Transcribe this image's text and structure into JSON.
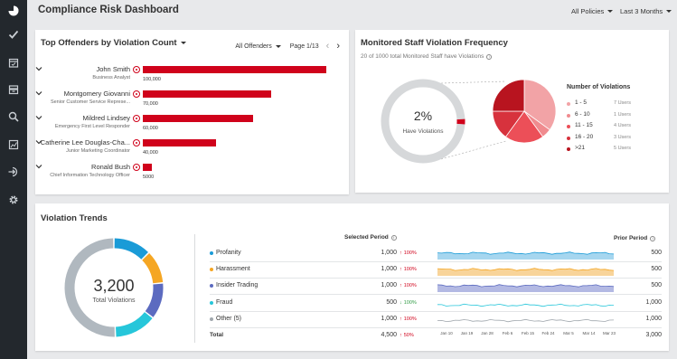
{
  "header": {
    "title": "Compliance Risk Dashboard",
    "policy_filter": "All Policies",
    "period_filter": "Last 3 Months"
  },
  "sidebar": {
    "items": [
      {
        "icon": "pie-chart-icon"
      },
      {
        "icon": "check-icon"
      },
      {
        "icon": "calendar-icon"
      },
      {
        "icon": "inbox-icon"
      },
      {
        "icon": "search-icon"
      },
      {
        "icon": "report-icon"
      },
      {
        "icon": "sign-in-icon"
      },
      {
        "icon": "gear-icon"
      }
    ]
  },
  "top_offenders": {
    "title": "Top Offenders by Violation Count",
    "filter": "All Offenders",
    "page": "Page 1/13",
    "max_value": 100000,
    "rows": [
      {
        "name": "John Smith",
        "role": "Business Analyst",
        "value": 100000,
        "value_label": "100,000"
      },
      {
        "name": "Montgomery Giovanni",
        "role": "Senior Customer Service Represe...",
        "value": 70000,
        "value_label": "70,000"
      },
      {
        "name": "Mildred Lindsey",
        "role": "Emergency First Level Responder",
        "value": 60000,
        "value_label": "60,000"
      },
      {
        "name": "Catherine Lee Douglas-Cha...",
        "role": "Junior Marketing Coordinator",
        "value": 40000,
        "value_label": "40,000"
      },
      {
        "name": "Ronald Bush",
        "role": "Chief Information Technology Officer",
        "value": 5000,
        "value_label": "5000"
      }
    ]
  },
  "monitored_staff": {
    "title": "Monitored Staff Violation Frequency",
    "subtitle": "20 of 1000 total Monitored Staff have Violations",
    "percent": "2%",
    "percent_fraction": 0.02,
    "percent_label": "Have Violations",
    "legend_title": "Number of Violations",
    "legend": [
      {
        "label": "1 - 5",
        "users": "7 Users",
        "count": 7,
        "color": "#f2a3a6"
      },
      {
        "label": "6 - 10",
        "users": "1 Users",
        "count": 1,
        "color": "#f08b8f"
      },
      {
        "label": "11 - 15",
        "users": "4 Users",
        "count": 4,
        "color": "#ec4f58"
      },
      {
        "label": "16 - 20",
        "users": "3 Users",
        "count": 3,
        "color": "#d7323d"
      },
      {
        "label": ">21",
        "users": "5 Users",
        "count": 5,
        "color": "#b8141f"
      }
    ]
  },
  "trends": {
    "title": "Violation Trends",
    "total": "3,200",
    "total_label": "Total Violations",
    "selected_period_label": "Selected Period",
    "prior_period_label": "Prior Period",
    "rows": [
      {
        "label": "Profanity",
        "value": "1,000",
        "change": "100%",
        "direction": "up",
        "prior": "500",
        "color": "#1a9bd7",
        "fill": "#a6d6ef"
      },
      {
        "label": "Harassment",
        "value": "1,000",
        "change": "100%",
        "direction": "up",
        "prior": "500",
        "color": "#f5a623",
        "fill": "#f8d49a"
      },
      {
        "label": "Insider Trading",
        "value": "1,000",
        "change": "100%",
        "direction": "up",
        "prior": "500",
        "color": "#5c6bc0",
        "fill": "#b3b9e3"
      },
      {
        "label": "Fraud",
        "value": "500",
        "change": "100%",
        "direction": "down",
        "prior": "1,000",
        "color": "#26c6da",
        "fill": "#9ee3ec"
      },
      {
        "label": "Other (5)",
        "value": "1,000",
        "change": "100%",
        "direction": "up",
        "prior": "1,000",
        "color": "#a0a7ad",
        "fill": "#d3d7da"
      }
    ],
    "total_row": {
      "label": "Total",
      "value": "4,500",
      "change": "50%",
      "direction": "up",
      "prior": "3,000"
    },
    "axis_labels": [
      "Jan 10",
      "Jan 19",
      "Jan 28",
      "Feb 6",
      "Feb 15",
      "Feb 24",
      "Mar 5",
      "Mar 14",
      "Mar 23"
    ],
    "donut_segments": [
      {
        "color": "#1a9bd7",
        "value": 0.125
      },
      {
        "color": "#f5a623",
        "value": 0.11
      },
      {
        "color": "#5c6bc0",
        "value": 0.12
      },
      {
        "color": "#26c6da",
        "value": 0.14
      },
      {
        "color": "#b0b8bf",
        "value": 0.505
      }
    ]
  }
}
